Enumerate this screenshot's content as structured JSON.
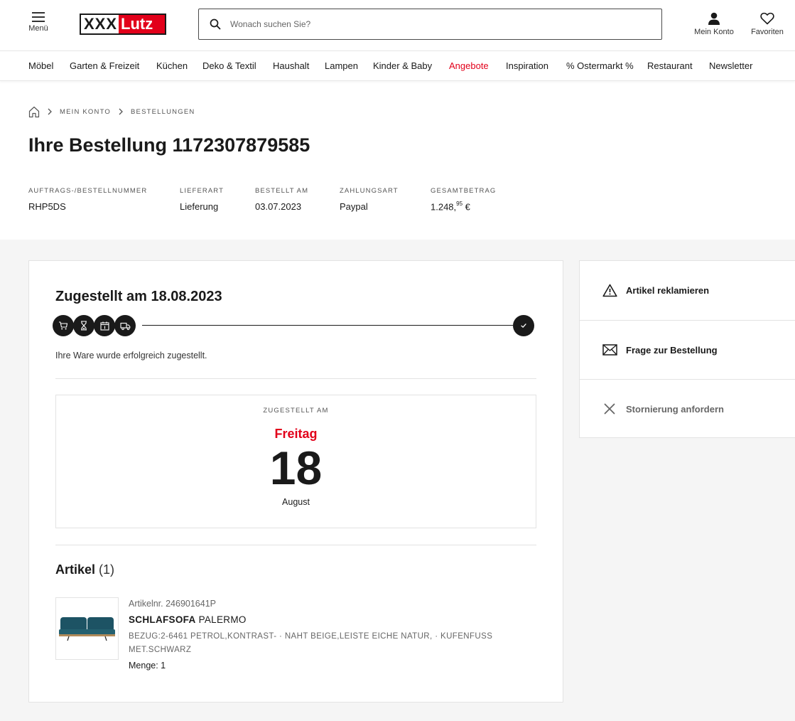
{
  "header": {
    "menu_label": "Menü",
    "logo_part1": "XXX",
    "logo_part2": "Lutz",
    "search_placeholder": "Wonach suchen Sie?",
    "account_label": "Mein Konto",
    "favorites_label": "Favoriten"
  },
  "nav": {
    "items": [
      "Möbel",
      "Garten & Freizeit",
      "Küchen",
      "Deko & Textil",
      "Haushalt",
      "Lampen",
      "Kinder & Baby",
      "Angebote",
      "Inspiration",
      "% Ostermarkt %",
      "Restaurant",
      "Newsletter"
    ],
    "highlight_color": "#e2001a"
  },
  "breadcrumb": {
    "items": [
      "MEIN KONTO",
      "BESTELLUNGEN"
    ]
  },
  "order": {
    "title": "Ihre Bestellung 1172307879585",
    "meta": [
      {
        "key": "AUFTRAGS-/BESTELLNUMMER",
        "value": "RHP5DS"
      },
      {
        "key": "LIEFERART",
        "value": "Lieferung"
      },
      {
        "key": "BESTELLT AM",
        "value": "03.07.2023"
      },
      {
        "key": "ZAHLUNGSART",
        "value": "Paypal"
      },
      {
        "key": "GESAMTBETRAG",
        "value_main": "1.248,",
        "value_cents": "95",
        "value_currency": " €"
      }
    ]
  },
  "status": {
    "title": "Zugestellt am 18.08.2023",
    "steps": [
      "cart-icon",
      "hourglass-icon",
      "calendar-icon",
      "truck-icon",
      "check-icon"
    ],
    "message": "Ihre Ware wurde erfolgreich zugestellt."
  },
  "delivery": {
    "label": "ZUGESTELLT AM",
    "weekday": "Freitag",
    "day": "18",
    "month": "August"
  },
  "articles": {
    "heading": "Artikel",
    "count": "(1)",
    "items": [
      {
        "article_nr": "Artikelnr. 246901641P",
        "name_bold": "SCHLAFSOFA",
        "name_rest": " PALERMO",
        "attributes": "BEZUG:2-6461 PETROL,KONTRAST- · NAHT BEIGE,LEISTE EICHE NATUR, · KUFENFUSS MET.SCHWARZ",
        "quantity": "Menge: 1"
      }
    ]
  },
  "actions": [
    {
      "label": "Artikel reklamieren",
      "icon": "warning-icon"
    },
    {
      "label": "Frage zur Bestellung",
      "icon": "mail-icon"
    },
    {
      "label": "Stornierung anfordern",
      "icon": "close-icon"
    }
  ],
  "colors": {
    "brand_red": "#e2001a",
    "text": "#1a1a1a",
    "background_grey": "#f5f5f5"
  }
}
